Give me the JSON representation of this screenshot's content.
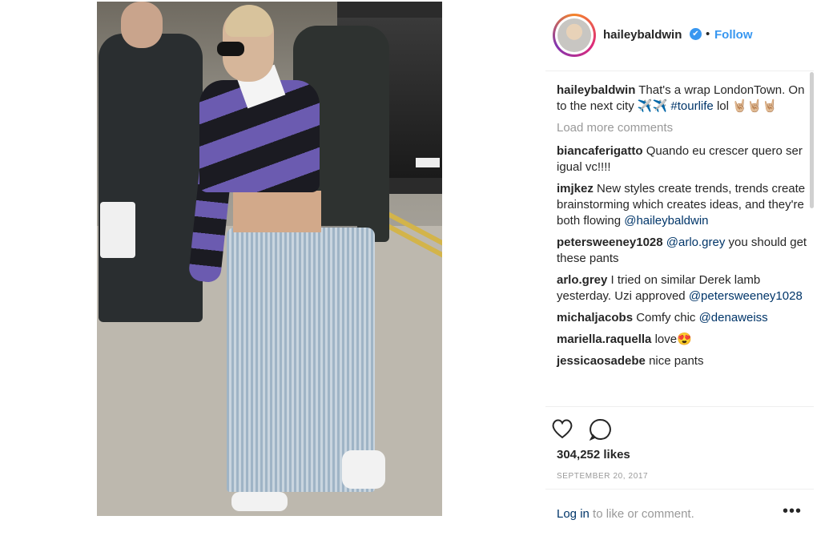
{
  "post": {
    "username": "haileybaldwin",
    "follow_label": "Follow",
    "separator": "•",
    "verified_glyph": "✔",
    "caption_user": "haileybaldwin",
    "caption_text": "That's a wrap LondonTown. On to the next city ✈️✈️ ",
    "caption_tag": "#tourlife",
    "caption_tail": " lol 🤘🏼🤘🏼🤘🏼",
    "load_more": "Load more comments",
    "comments": [
      {
        "user": "biancaferigatto",
        "text": "Quando eu crescer quero ser igual vc!!!!",
        "mention": ""
      },
      {
        "user": "imjkez",
        "text": "New styles create trends, trends create brainstorming which creates ideas, and they're both flowing ",
        "mention": "@haileybaldwin"
      },
      {
        "user": "petersweeney1028",
        "text": "",
        "mention": "@arlo.grey",
        "tail": " you should get these pants"
      },
      {
        "user": "arlo.grey",
        "text": "I tried on similar Derek lamb yesterday. Uzi approved ",
        "mention": "@petersweeney1028"
      },
      {
        "user": "michaljacobs",
        "text": "Comfy chic ",
        "mention": "@denaweiss"
      },
      {
        "user": "mariella.raquella",
        "text": "love😍",
        "mention": ""
      },
      {
        "user": "jessicaosadebe",
        "text": "nice pants",
        "mention": ""
      }
    ],
    "likes": "304,252 likes",
    "date": "SEPTEMBER 20, 2017",
    "login_link": "Log in",
    "login_tail": " to like or comment.",
    "more_label": "•••"
  },
  "icons": {
    "like": "heart-icon",
    "comment": "comment-bubble-icon",
    "more": "more-options-icon",
    "verified": "verified-badge-icon"
  },
  "colors": {
    "link": "#3897f0",
    "mention": "#003569",
    "muted": "#999999"
  }
}
